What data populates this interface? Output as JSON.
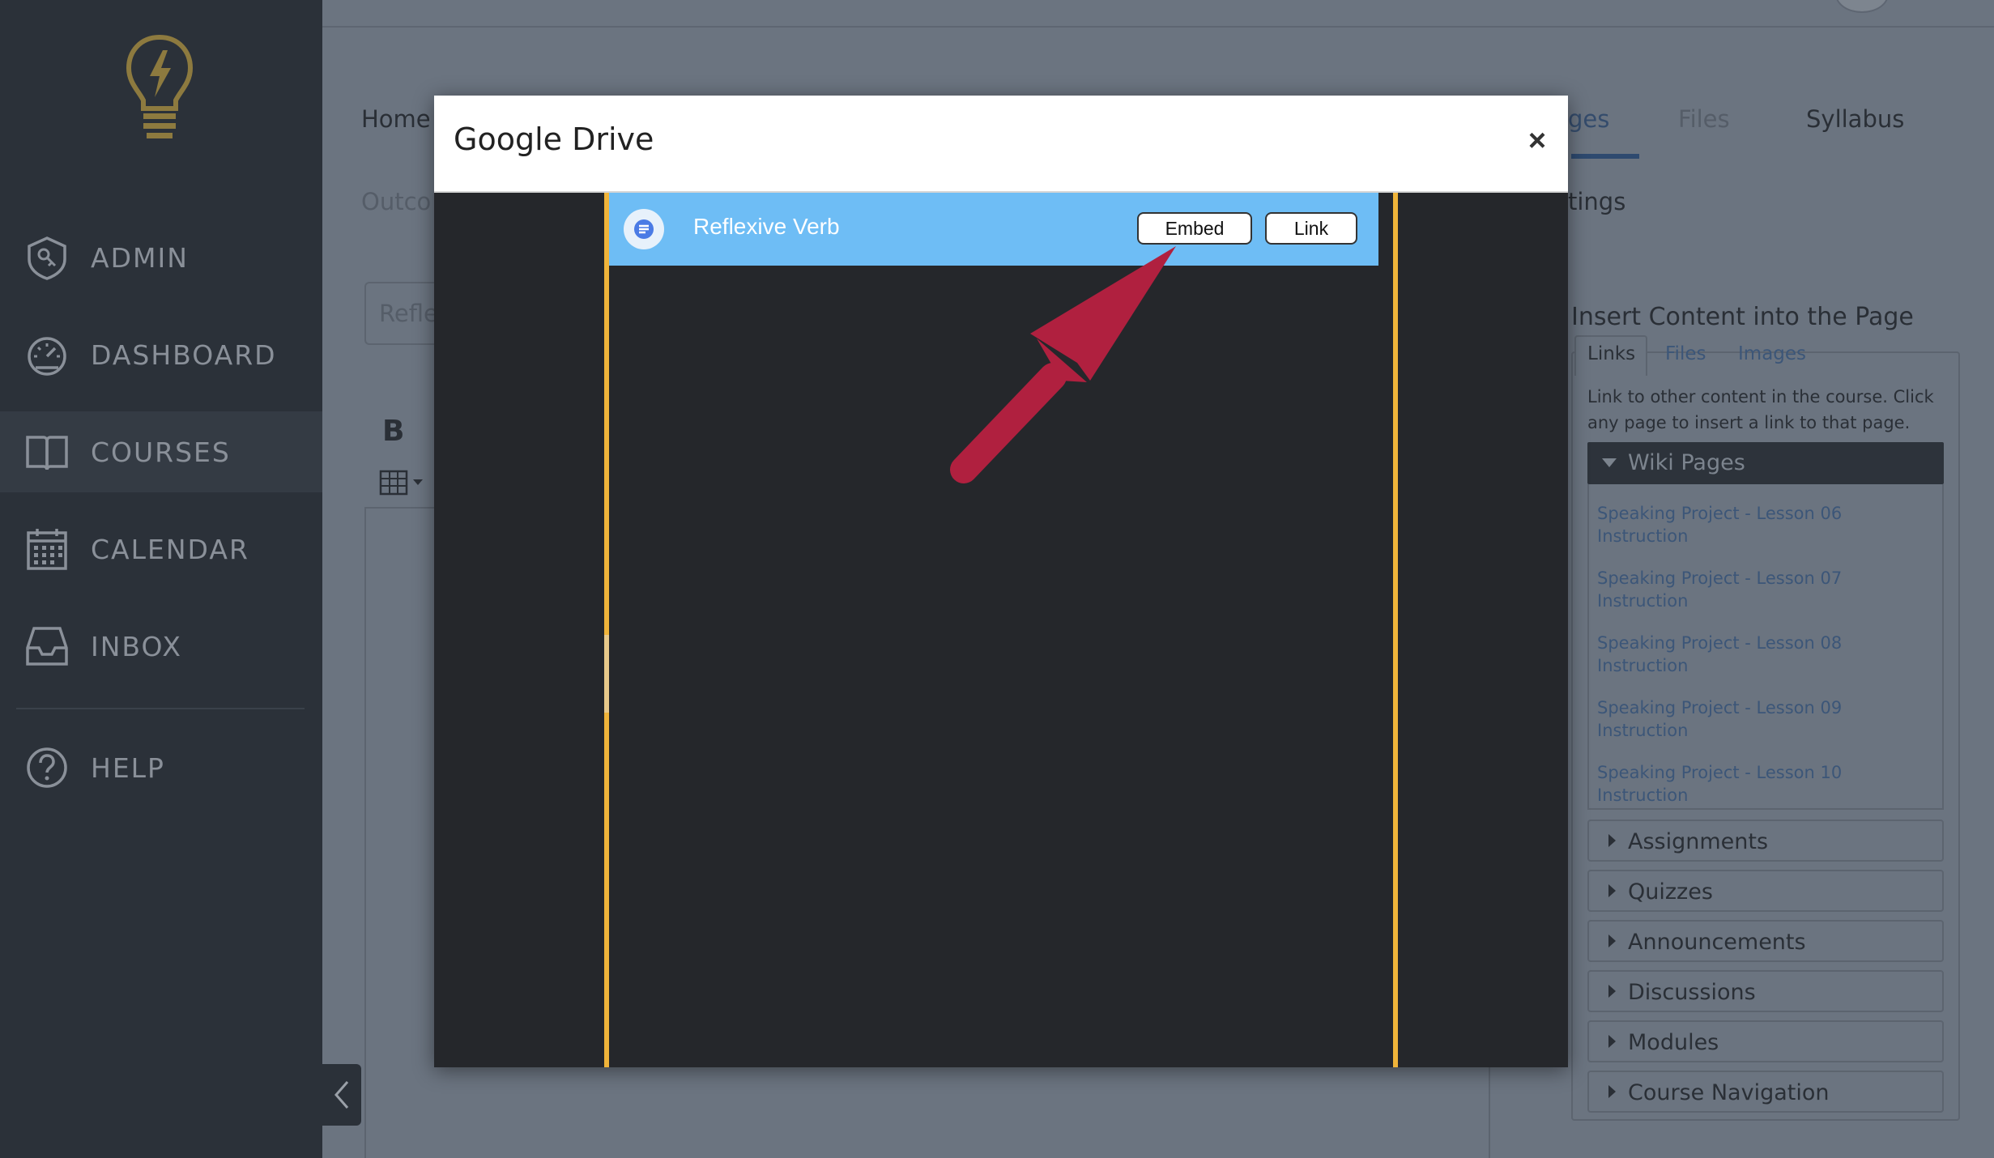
{
  "sidebar": {
    "items": [
      {
        "label": "ADMIN",
        "icon": "admin-shield-icon"
      },
      {
        "label": "DASHBOARD",
        "icon": "speedometer-icon"
      },
      {
        "label": "COURSES",
        "icon": "book-icon"
      },
      {
        "label": "CALENDAR",
        "icon": "calendar-icon"
      },
      {
        "label": "INBOX",
        "icon": "inbox-icon"
      },
      {
        "label": "HELP",
        "icon": "help-circle-icon"
      }
    ],
    "active": "COURSES",
    "logo_color": "#8d7a3f"
  },
  "course_nav": {
    "home": "Home",
    "pages_partial": "ges",
    "files": "Files",
    "syllabus": "Syllabus",
    "outcomes_partial": "Outco",
    "settings_partial": "tings"
  },
  "editor": {
    "title_partial": "Refle",
    "bold_label": "B"
  },
  "insert_panel": {
    "heading": "Insert Content into the Page",
    "tabs": [
      "Links",
      "Files",
      "Images"
    ],
    "description": "Link to other content in the course. Click any page to insert a link to that page.",
    "wiki_pages_label": "Wiki Pages",
    "wiki_pages": [
      {
        "line1": "Speaking Project - Lesson 06",
        "line2": "Instruction"
      },
      {
        "line1": "Speaking Project - Lesson 07",
        "line2": "Instruction"
      },
      {
        "line1": "Speaking Project - Lesson 08",
        "line2": "Instruction"
      },
      {
        "line1": "Speaking Project - Lesson 09",
        "line2": "Instruction"
      },
      {
        "line1": "Speaking Project - Lesson 10",
        "line2": "Instruction"
      }
    ],
    "sections": [
      "Assignments",
      "Quizzes",
      "Announcements",
      "Discussions",
      "Modules",
      "Course Navigation"
    ]
  },
  "modal": {
    "title": "Google Drive",
    "close_symbol": "×",
    "document": {
      "name": "Reflexive Verb",
      "icon": "google-docs-icon",
      "embed_label": "Embed",
      "link_label": "Link"
    },
    "highlight_color": "#6ebdf5",
    "frame_border_color": "#f0b43a",
    "annotation_arrow_color": "#b0203f"
  }
}
